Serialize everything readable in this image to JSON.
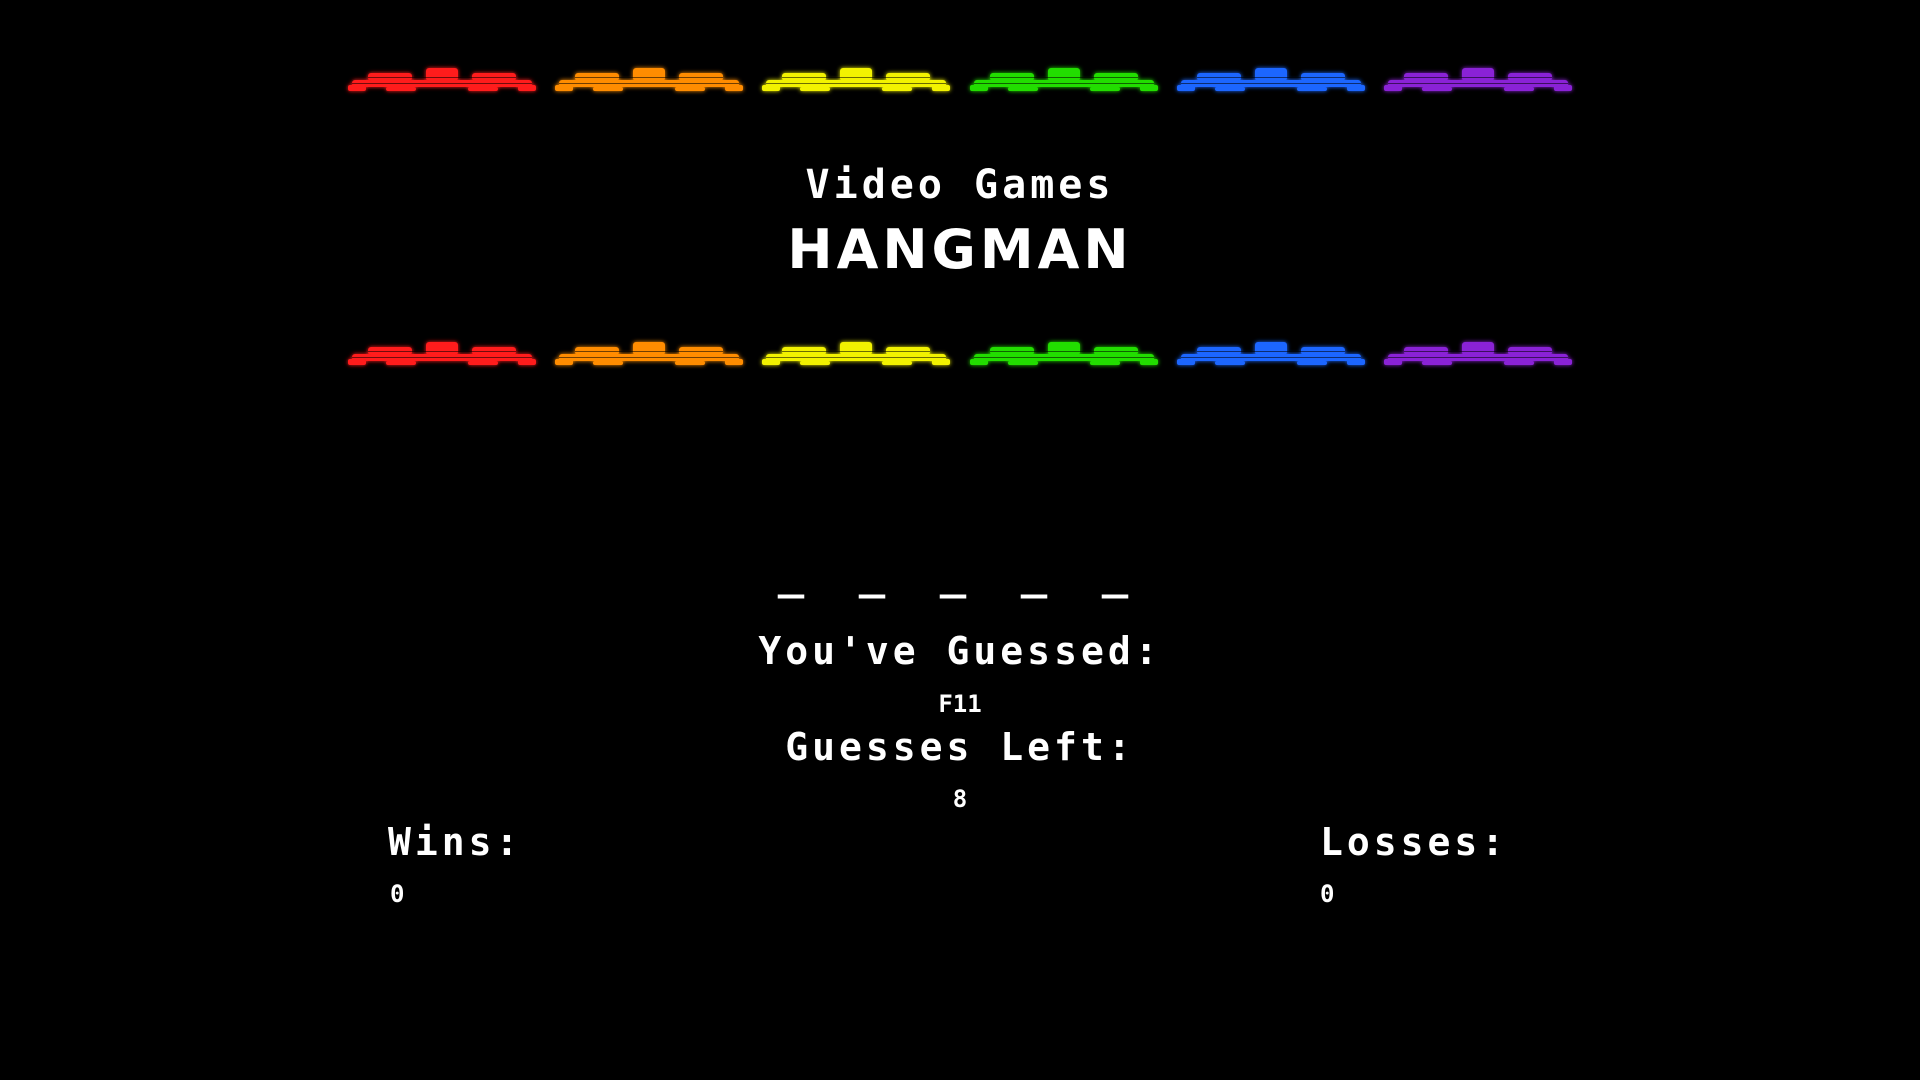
{
  "header": {
    "category": "Video Games",
    "title": "HANGMAN"
  },
  "ship_colors": [
    "#ff1a1a",
    "#ff8c00",
    "#f2f200",
    "#22dd00",
    "#1a66ff",
    "#8a22d6"
  ],
  "ship_icon": "space-invader-ship-icon",
  "game": {
    "word_display": "_ _ _ _ _",
    "guessed_label": "You've Guessed:",
    "guessed_value": "F11",
    "guesses_left_label": "Guesses Left:",
    "guesses_left_value": "8"
  },
  "score": {
    "wins_label": "Wins:",
    "wins_value": "0",
    "losses_label": "Losses:",
    "losses_value": "0"
  }
}
